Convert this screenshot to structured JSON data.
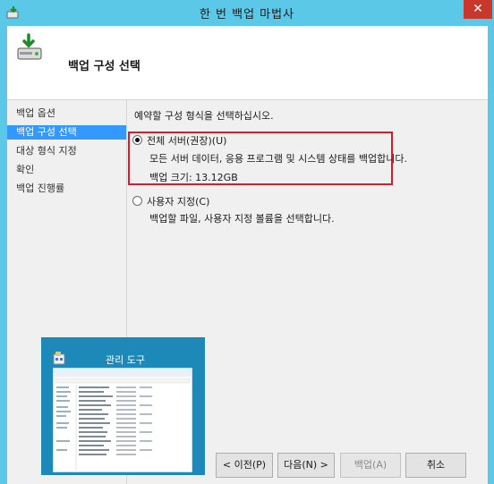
{
  "window": {
    "title": "한 번 백업 마법사",
    "close_glyph": "✕"
  },
  "header": {
    "title": "백업 구성 선택"
  },
  "nav": {
    "items": [
      {
        "label": "백업 옵션"
      },
      {
        "label": "백업 구성 선택"
      },
      {
        "label": "대상 형식 지정"
      },
      {
        "label": "확인"
      },
      {
        "label": "백업 진행률"
      }
    ],
    "active_index": 1
  },
  "main": {
    "instruction": "예약할 구성 형식을 선택하십시오.",
    "options": [
      {
        "label": "전체 서버(권장)(U)",
        "description": "모든 서버 데이터, 응용 프로그램 및 시스템 상태를 백업합니다.",
        "size_text": "백업 크기: 13.12GB",
        "selected": true
      },
      {
        "label": "사용자 지정(C)",
        "description": "백업할 파일, 사용자 지정 볼륨을 선택합니다.",
        "selected": false
      }
    ]
  },
  "thumbnail": {
    "title": "관리 도구"
  },
  "buttons": {
    "prev": "< 이전(P)",
    "next": "다음(N) >",
    "backup": "백업(A)",
    "cancel": "취소"
  },
  "colors": {
    "titlebar": "#5cc8e8",
    "selection": "#3399ff",
    "highlight_border": "#e0192a",
    "thumbnail_bg": "#1c89b8"
  }
}
